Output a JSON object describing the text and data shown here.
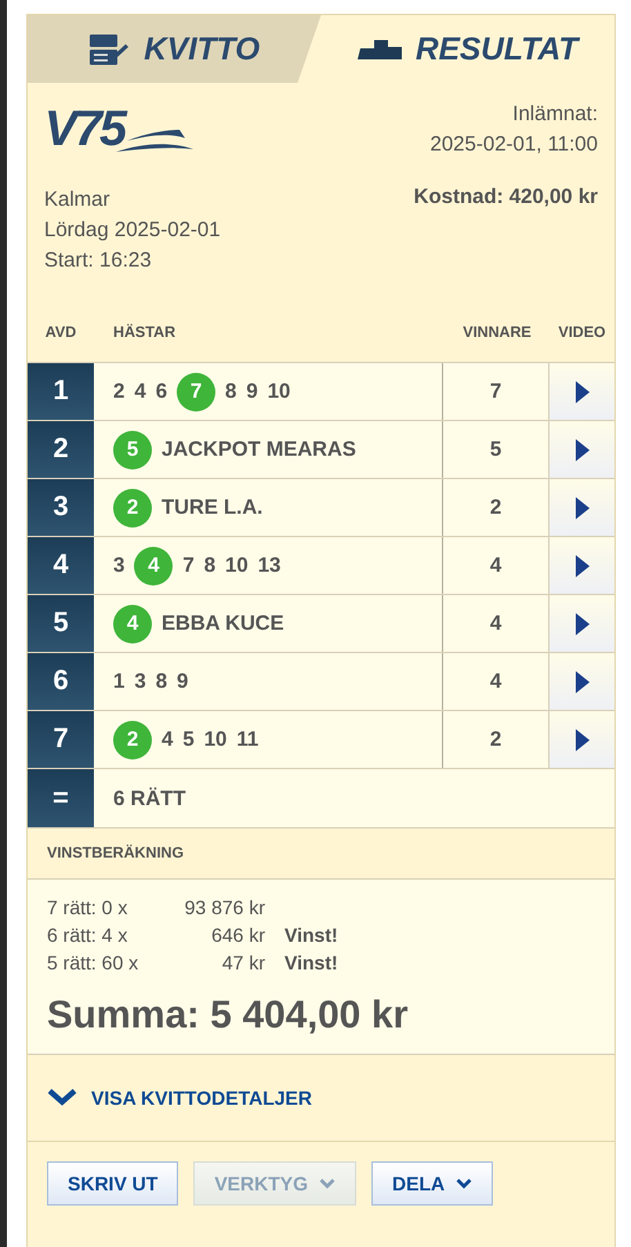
{
  "tabs": [
    {
      "label": "KVITTO",
      "kind": "receipt",
      "selected": false
    },
    {
      "label": "RESULTAT",
      "kind": "podium",
      "selected": true
    }
  ],
  "logo": {
    "text": "V75"
  },
  "submitted": {
    "label": "Inlämnat:",
    "value": "2025-02-01, 11:00"
  },
  "event": {
    "track": "Kalmar",
    "date": "Lördag 2025-02-01",
    "start": "Start: 16:23",
    "cost": "Kostnad: 420,00 kr"
  },
  "table": {
    "columns": [
      "AVD",
      "HÄSTAR",
      "VINNARE",
      "VIDEO"
    ],
    "rows": [
      {
        "leg": "1",
        "horses": [
          {
            "number": "2",
            "winner": false
          },
          {
            "number": "4",
            "winner": false
          },
          {
            "number": "6",
            "winner": false
          },
          {
            "number": "7",
            "winner": true
          },
          {
            "number": "8",
            "winner": false
          },
          {
            "number": "9",
            "winner": false
          },
          {
            "number": "10",
            "winner": false
          }
        ],
        "winner": "7"
      },
      {
        "leg": "2",
        "horses": [
          {
            "number": "5",
            "winner": true
          }
        ],
        "name": "JACKPOT MEARAS",
        "winner": "5"
      },
      {
        "leg": "3",
        "horses": [
          {
            "number": "2",
            "winner": true
          }
        ],
        "name": "TURE L.A.",
        "winner": "2"
      },
      {
        "leg": "4",
        "horses": [
          {
            "number": "3",
            "winner": false
          },
          {
            "number": "4",
            "winner": true
          },
          {
            "number": "7",
            "winner": false
          },
          {
            "number": "8",
            "winner": false
          },
          {
            "number": "10",
            "winner": false
          },
          {
            "number": "13",
            "winner": false
          }
        ],
        "winner": "4"
      },
      {
        "leg": "5",
        "horses": [
          {
            "number": "4",
            "winner": true
          }
        ],
        "name": "EBBA KUCE",
        "winner": "4"
      },
      {
        "leg": "6",
        "horses": [
          {
            "number": "1",
            "winner": false
          },
          {
            "number": "3",
            "winner": false
          },
          {
            "number": "8",
            "winner": false
          },
          {
            "number": "9",
            "winner": false
          }
        ],
        "winner": "4"
      },
      {
        "leg": "7",
        "horses": [
          {
            "number": "2",
            "winner": true
          },
          {
            "number": "4",
            "winner": false
          },
          {
            "number": "5",
            "winner": false
          },
          {
            "number": "10",
            "winner": false
          },
          {
            "number": "11",
            "winner": false
          }
        ],
        "winner": "2"
      }
    ],
    "total": {
      "symbol": "=",
      "text": "6 RÄTT"
    }
  },
  "winnings": {
    "title": "VINSTBERÄKNING",
    "lines": [
      {
        "label": "7 rätt: 0 x",
        "amount": "93 876 kr"
      },
      {
        "label": "6 rätt: 4 x",
        "amount": "646 kr",
        "note": "Vinst!"
      },
      {
        "label": "5 rätt: 60 x",
        "amount": "47 kr",
        "note": "Vinst!"
      }
    ],
    "sum": "Summa: 5 404,00 kr"
  },
  "details_link": "VISA KVITTODETALJER",
  "buttons": [
    {
      "label": "SKRIV UT",
      "dropdown": false,
      "disabled": false
    },
    {
      "label": "VERKTYG",
      "dropdown": true,
      "disabled": true
    },
    {
      "label": "DELA",
      "dropdown": true,
      "disabled": false
    }
  ]
}
